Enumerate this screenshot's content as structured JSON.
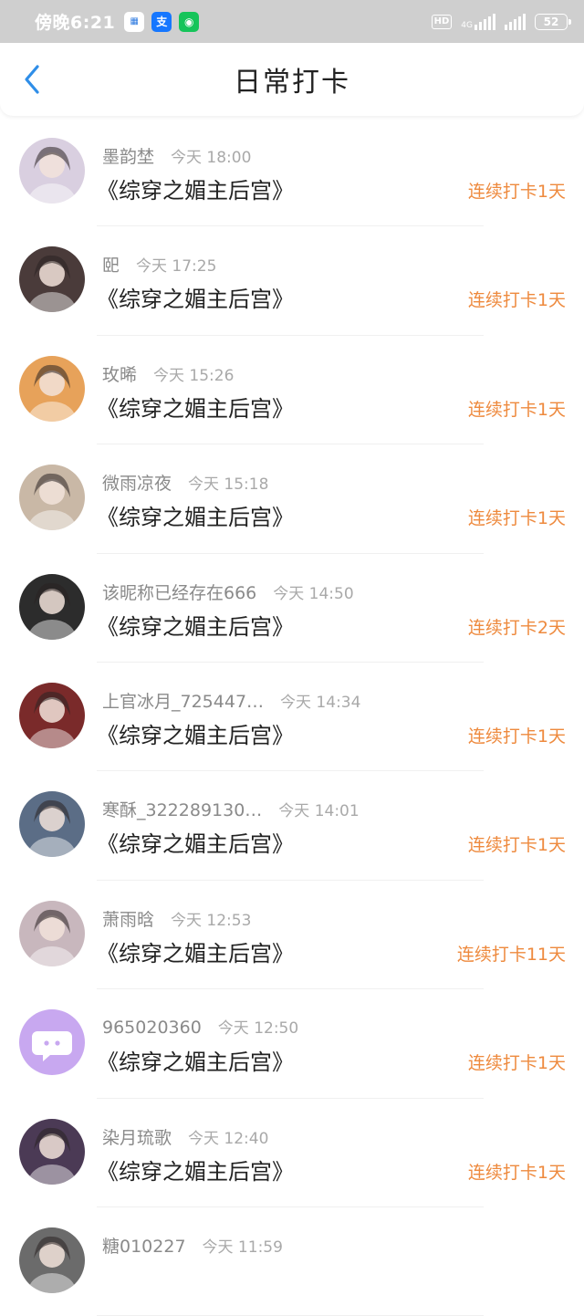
{
  "status_bar": {
    "time": "傍晚6:21",
    "apps": [
      "calendar-icon",
      "alipay-icon",
      "chat-icon"
    ],
    "network": "4G",
    "hd": "HD",
    "battery": "52"
  },
  "header": {
    "title": "日常打卡",
    "back_icon": "chevron-left-icon",
    "accent": "#2f8ee8"
  },
  "colors": {
    "streak": "#ee8a3e",
    "name": "#8a8a8a",
    "title": "#222222"
  },
  "checkins": [
    {
      "name": "墨韵埜",
      "time": "今天 18:00",
      "book": "《综穿之媚主后宫》",
      "streak": "连续打卡1天",
      "avatar_color": "#d9cfe0"
    },
    {
      "name": "巸",
      "time": "今天 17:25",
      "book": "《综穿之媚主后宫》",
      "streak": "连续打卡1天",
      "avatar_color": "#4a3b3a"
    },
    {
      "name": "玫晞",
      "time": "今天 15:26",
      "book": "《综穿之媚主后宫》",
      "streak": "连续打卡1天",
      "avatar_color": "#e7a25a"
    },
    {
      "name": "微雨凉夜",
      "time": "今天 15:18",
      "book": "《综穿之媚主后宫》",
      "streak": "连续打卡1天",
      "avatar_color": "#c9b8a6"
    },
    {
      "name": "该昵称已经存在666",
      "time": "今天 14:50",
      "book": "《综穿之媚主后宫》",
      "streak": "连续打卡2天",
      "avatar_color": "#2c2c2c"
    },
    {
      "name": "上官冰月_725447…",
      "time": "今天 14:34",
      "book": "《综穿之媚主后宫》",
      "streak": "连续打卡1天",
      "avatar_color": "#7a2a2a"
    },
    {
      "name": "寒酥_322289130…",
      "time": "今天 14:01",
      "book": "《综穿之媚主后宫》",
      "streak": "连续打卡1天",
      "avatar_color": "#5b6d86"
    },
    {
      "name": "萧雨晗",
      "time": "今天 12:53",
      "book": "《综穿之媚主后宫》",
      "streak": "连续打卡11天",
      "avatar_color": "#c8b7bd"
    },
    {
      "name": "965020360",
      "time": "今天 12:50",
      "book": "《综穿之媚主后宫》",
      "streak": "连续打卡1天",
      "avatar_color": "#c8a8f0"
    },
    {
      "name": "染月琉歌",
      "time": "今天 12:40",
      "book": "《综穿之媚主后宫》",
      "streak": "连续打卡1天",
      "avatar_color": "#4b3a55"
    },
    {
      "name": "糖010227",
      "time": "今天 11:59",
      "book": "",
      "streak": "",
      "avatar_color": "#6b6b6b"
    }
  ]
}
